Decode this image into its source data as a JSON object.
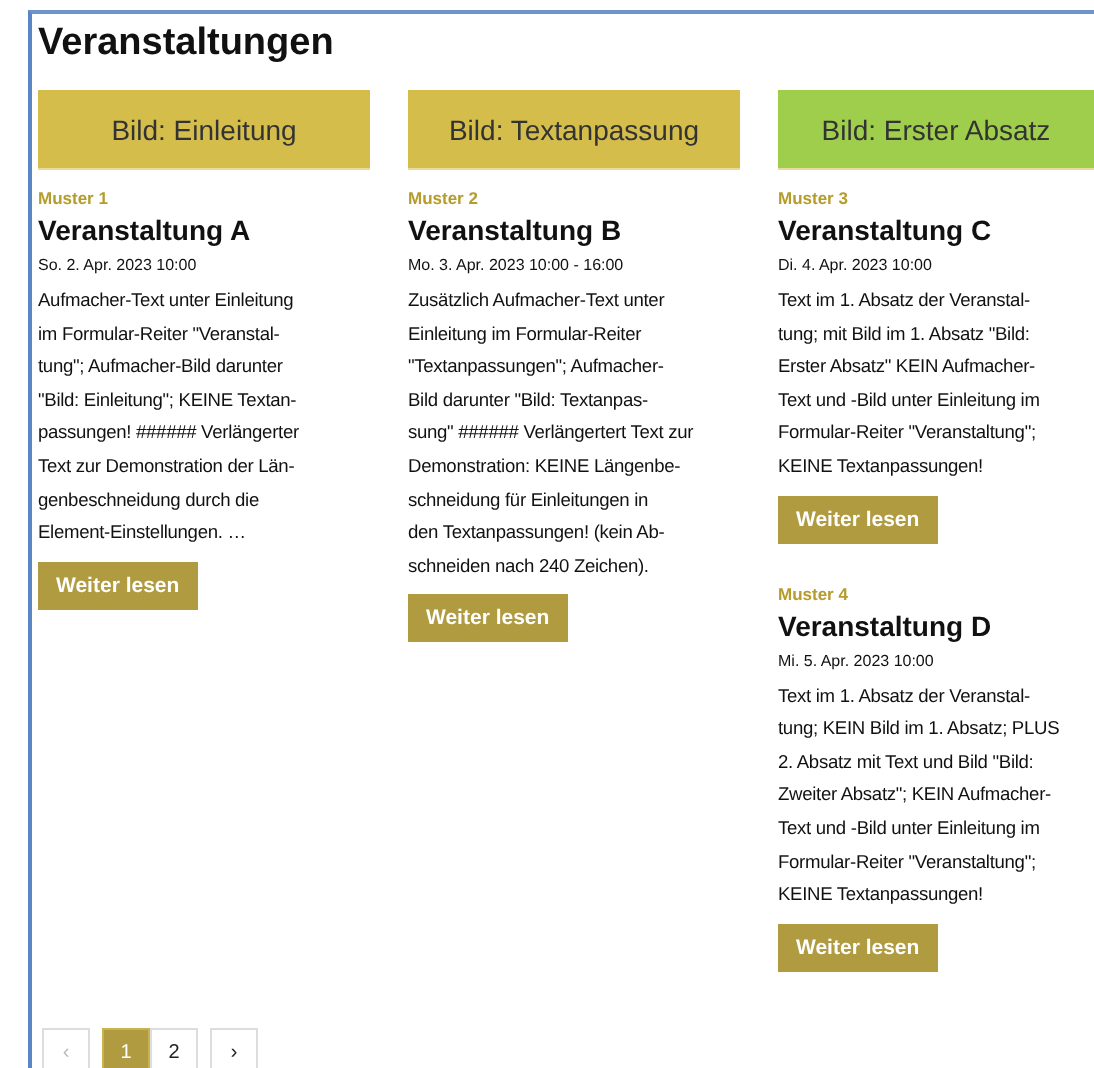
{
  "heading": "Veranstaltungen",
  "columns": [
    [
      {
        "image": {
          "label": "Bild: Einleitung",
          "color": "#d4bd4b"
        },
        "category": "Muster 1",
        "title": "Veranstaltung A",
        "date": "So. 2. Apr. 2023 10:00",
        "text": [
          "Aufmacher-Text unter Einleitung",
          "im Formular-Reiter \"Veranstal-",
          "tung\"; Aufmacher-Bild darunter",
          "\"Bild: Einleitung\"; KEINE Textan-",
          "passungen! ###### Verlängerter",
          "Text zur Demonstration der Län-",
          "genbeschneidung durch die",
          "Element-Einstellungen. …"
        ],
        "button": "Weiter lesen"
      }
    ],
    [
      {
        "image": {
          "label": "Bild: Textanpassung",
          "color": "#d4bd4b"
        },
        "category": "Muster 2",
        "title": "Veranstaltung B",
        "date": "Mo. 3. Apr. 2023 10:00 - 16:00",
        "text": [
          "Zusätzlich Aufmacher-Text unter",
          "Einleitung im Formular-Reiter",
          "\"Textanpassungen\"; Aufmacher-",
          "Bild darunter \"Bild: Textanpas-",
          "sung\" ###### Verlängertert Text zur",
          "Demonstration: KEINE Längenbe-",
          "schneidung für Einleitungen in",
          "den Textanpassungen! (kein Ab-",
          "schneiden nach 240 Zeichen)."
        ],
        "button": "Weiter lesen"
      }
    ],
    [
      {
        "image": {
          "label": "Bild: Erster Absatz",
          "color": "#9fce4c"
        },
        "category": "Muster 3",
        "title": "Veranstaltung C",
        "date": "Di. 4. Apr. 2023 10:00",
        "text": [
          "Text im 1. Absatz der Veranstal-",
          "tung; mit Bild im 1. Absatz \"Bild:",
          "Erster Absatz\" KEIN Aufmacher-",
          "Text und -Bild unter Einleitung im",
          "Formular-Reiter \"Veranstaltung\";",
          "KEINE Textanpassungen!"
        ],
        "button": "Weiter lesen"
      },
      {
        "category": "Muster 4",
        "title": "Veranstaltung D",
        "date": "Mi. 5. Apr. 2023 10:00",
        "text": [
          "Text im 1. Absatz der Veranstal-",
          "tung; KEIN Bild im 1. Absatz; PLUS",
          "2. Absatz mit Text und Bild \"Bild:",
          "Zweiter Absatz\"; KEIN Aufmacher-",
          "Text und -Bild unter Einleitung im",
          "Formular-Reiter \"Veranstaltung\";",
          "KEINE Textanpassungen!"
        ],
        "button": "Weiter lesen"
      }
    ]
  ],
  "pagination": {
    "previous": {
      "label": "‹",
      "disabled": true
    },
    "pages": [
      {
        "label": "1",
        "selected": true
      },
      {
        "label": "2",
        "selected": false
      }
    ],
    "next": {
      "label": "›",
      "disabled": false
    }
  }
}
